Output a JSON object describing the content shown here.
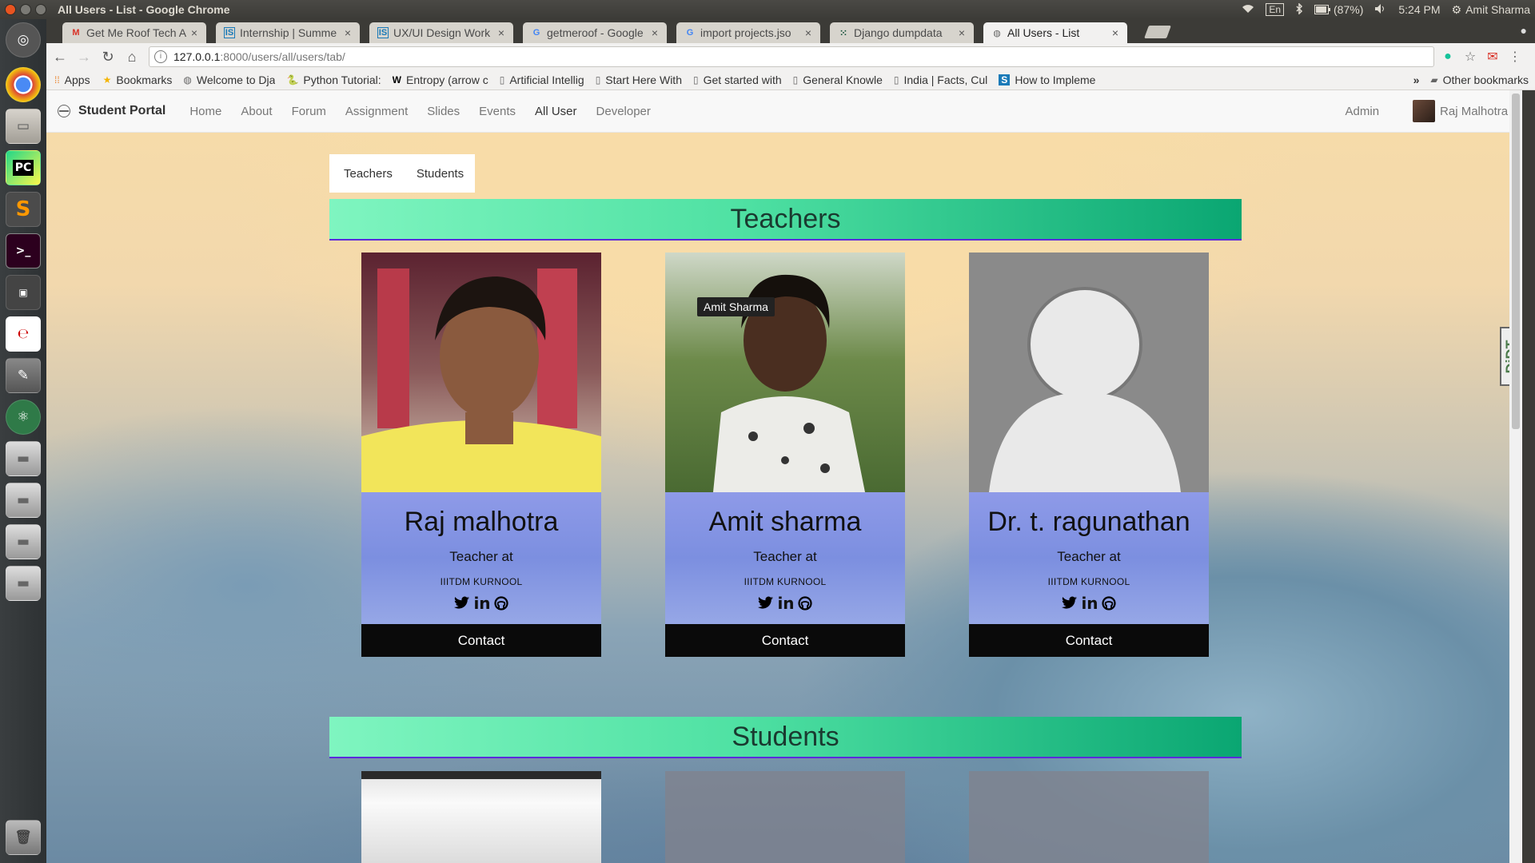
{
  "os": {
    "window_title": "All Users - List - Google Chrome",
    "keyboard": "En",
    "battery": "(87%)",
    "time": "5:24 PM",
    "user": "Amit Sharma"
  },
  "launcher": [
    "chromium-icon",
    "chrome-icon",
    "files-icon",
    "pycharm-icon",
    "sublime-icon",
    "terminal-icon",
    "workspace-icon",
    "text-editor-icon",
    "settings-icon",
    "atom-icon",
    "drive-icon",
    "drive-icon",
    "drive-icon",
    "drive-icon",
    "trash-icon"
  ],
  "tabs": [
    {
      "title": "Get Me Roof Tech A",
      "icon": "gmail-icon"
    },
    {
      "title": "Internship | Summe",
      "icon": "internshala-icon"
    },
    {
      "title": "UX/UI Design Work",
      "icon": "internshala-icon"
    },
    {
      "title": "getmeroof - Google",
      "icon": "google-icon"
    },
    {
      "title": "import projects.jso",
      "icon": "google-icon"
    },
    {
      "title": "Django dumpdata",
      "icon": "django-icon"
    },
    {
      "title": "All Users - List",
      "icon": "globe-icon"
    }
  ],
  "omnibox": {
    "url_host": "127.0.0.1",
    "url_rest": ":8000/users/all/users/tab/"
  },
  "bookmarks": {
    "apps": "Apps",
    "items": [
      "Bookmarks",
      "Welcome to Dja",
      "Python Tutorial:",
      "Entropy (arrow c",
      "Artificial Intellig",
      "Start Here With",
      "Get started with",
      "General Knowle",
      "India | Facts, Cul",
      "How to Impleme"
    ],
    "more": "»",
    "other": "Other bookmarks"
  },
  "navbar": {
    "brand": "Student Portal",
    "links": [
      "Home",
      "About",
      "Forum",
      "Assignment",
      "Slides",
      "Events",
      "All User",
      "Developer"
    ],
    "active_index": 6,
    "admin": "Admin",
    "user": "Raj Malhotra"
  },
  "tabs_panel": {
    "teachers": "Teachers",
    "students": "Students"
  },
  "sections": {
    "teachers": "Teachers",
    "students": "Students"
  },
  "teachers": [
    {
      "name": "Raj malhotra",
      "role": "Teacher at",
      "org": "IIITDM KURNOOL",
      "contact": "Contact"
    },
    {
      "name": "Amit sharma",
      "role": "Teacher at",
      "org": "IIITDM KURNOOL",
      "contact": "Contact",
      "tooltip": "Amit Sharma"
    },
    {
      "name": "Dr. t. ragunathan",
      "role": "Teacher at",
      "org": "IIITDM KURNOOL",
      "contact": "Contact"
    }
  ],
  "debug_toolbar": "DjDT"
}
